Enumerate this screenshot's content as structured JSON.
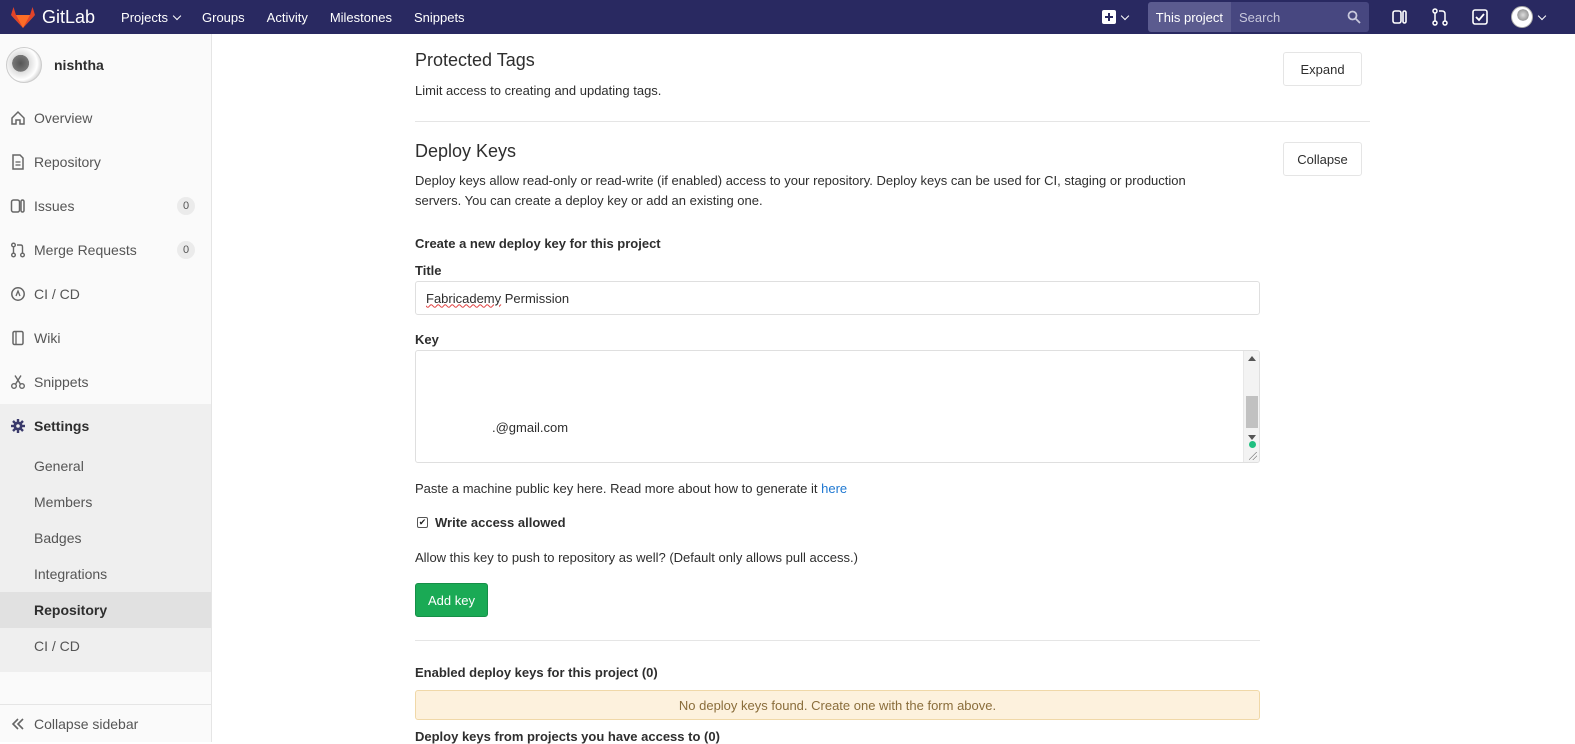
{
  "navbar": {
    "brand": "GitLab",
    "links": [
      "Projects",
      "Groups",
      "Activity",
      "Milestones",
      "Snippets"
    ],
    "scope_label": "This project",
    "search_placeholder": "Search",
    "color": "#292961"
  },
  "sidebar": {
    "project_name": "nishtha",
    "items": [
      {
        "label": "Overview",
        "icon": "home-icon"
      },
      {
        "label": "Repository",
        "icon": "doc-icon"
      },
      {
        "label": "Issues",
        "icon": "issues-icon",
        "count": "0"
      },
      {
        "label": "Merge Requests",
        "icon": "merge-request-icon",
        "count": "0"
      },
      {
        "label": "CI / CD",
        "icon": "rocket-icon"
      },
      {
        "label": "Wiki",
        "icon": "book-icon"
      },
      {
        "label": "Snippets",
        "icon": "scissors-icon"
      },
      {
        "label": "Settings",
        "icon": "gear-icon"
      }
    ],
    "settings_sub": [
      "General",
      "Members",
      "Badges",
      "Integrations",
      "Repository",
      "CI / CD"
    ],
    "active_sub": "Repository",
    "collapse_label": "Collapse sidebar"
  },
  "protected_tags": {
    "title": "Protected Tags",
    "description": "Limit access to creating and updating tags.",
    "button": "Expand"
  },
  "deploy_keys": {
    "title": "Deploy Keys",
    "description_line1": "Deploy keys allow read-only or read-write (if enabled) access to your repository. Deploy keys can be used for CI, staging or production",
    "description_line2": "servers. You can create a deploy key or add an existing one.",
    "button": "Collapse",
    "form_heading": "Create a new deploy key for this project",
    "title_label": "Title",
    "title_value_word": "Fabricademy",
    "title_value_rest": " Permission",
    "key_label": "Key",
    "key_visible_text": ".@gmail.com",
    "help_text": "Paste a machine public key here. Read more about how to generate it ",
    "help_link": "here",
    "write_access_label": "Write access allowed",
    "write_access_checked": true,
    "write_access_help": "Allow this key to push to repository as well? (Default only allows pull access.)",
    "add_button": "Add key",
    "enabled_heading": "Enabled deploy keys for this project (0)",
    "empty_message": "No deploy keys found. Create one with the form above.",
    "other_heading": "Deploy keys from projects you have access to (0)"
  },
  "colors": {
    "accent_green": "#1aaa55",
    "link": "#1f78d1",
    "warning_bg": "#fdf1dd"
  }
}
